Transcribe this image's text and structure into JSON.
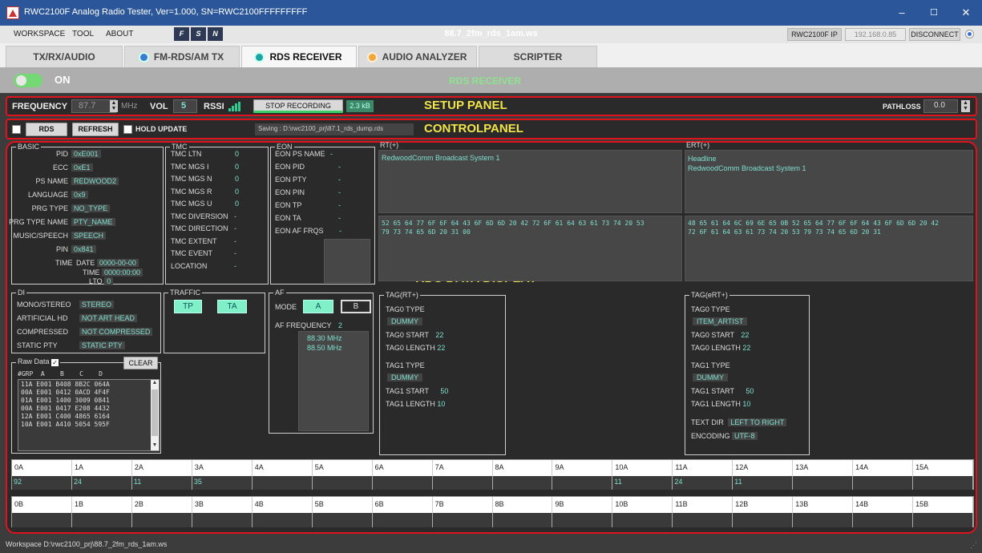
{
  "window": {
    "title": "RWC2100F Analog Radio Tester, Ver=1.000, SN=RWC2100FFFFFFFFF",
    "minimize": "–",
    "maximize": "☐",
    "close": "✕"
  },
  "menu": {
    "items": [
      "WORKSPACE",
      "TOOL",
      "ABOUT"
    ],
    "toolbar_icons": [
      "F",
      "S",
      "N"
    ],
    "file": "88.7_2fm_rds_1am.ws",
    "ip_label": "RWC2100F IP",
    "ip_value": "192.168.0.85",
    "disconnect": "DISCONNECT"
  },
  "tabs": [
    {
      "label": "TX/RX/AUDIO"
    },
    {
      "label": "FM-RDS/AM TX",
      "dot": "#3a7bd5"
    },
    {
      "label": "RDS RECEIVER",
      "dot": "#19a5a5"
    },
    {
      "label": "AUDIO ANALYZER",
      "dot": "#f3a73b"
    },
    {
      "label": "SCRIPTER"
    }
  ],
  "power": {
    "state": "ON",
    "title": "RDS RECEIVER"
  },
  "setup": {
    "frequency_label": "FREQUENCY",
    "frequency": "87.7",
    "unit": "MHz",
    "vol_label": "VOL",
    "vol": "5",
    "rssi_label": "RSSI",
    "recording_btn": "STOP RECORDING",
    "size": "2.3 kB",
    "panel_label": "SETUP PANEL",
    "pathloss_label": "PATHLOSS",
    "pathloss": "0.0"
  },
  "control": {
    "rds_btn": "RDS",
    "refresh_btn": "REFRESH",
    "hold_update": "HOLD UPDATE",
    "saving": "Saving : D:\\rwc2100_prj\\87.1_rds_dump.rds",
    "panel_label": "CONTROLPANEL"
  },
  "display_label": "RDS DATA DISPLAY",
  "basic": {
    "title": "BASIC",
    "pid_l": "PID",
    "pid": "0xE001",
    "ecc_l": "ECC",
    "ecc": "0xE1",
    "ps_l": "PS NAME",
    "ps": "REDWOOD2",
    "lang_l": "LANGUAGE",
    "lang": "0x9",
    "prg_l": "PRG TYPE",
    "prg": "NO_TYPE",
    "prgn_l": "PRG TYPE NAME",
    "prgn": "PTY_NAME",
    "ms_l": "MUSIC/SPEECH",
    "ms": "SPEECH",
    "pin_l": "PIN",
    "pin": "0x841",
    "time_l": "TIME",
    "date_l": "DATE",
    "date": "0000-00-00",
    "time2_l": "TIME",
    "time2": "0000:00:00",
    "lto_l": "LTO",
    "lto": "0"
  },
  "tmc": {
    "title": "TMC",
    "rows": [
      {
        "l": "TMC LTN",
        "v": "0"
      },
      {
        "l": "TMC MGS I",
        "v": "0"
      },
      {
        "l": "TMC MGS N",
        "v": "0"
      },
      {
        "l": "TMC MGS R",
        "v": "0"
      },
      {
        "l": "TMC MGS U",
        "v": "0"
      },
      {
        "l": "TMC DIVERSION",
        "v": "-"
      },
      {
        "l": "TMC DIRECTION",
        "v": "-"
      },
      {
        "l": "TMC EXTENT",
        "v": "-"
      },
      {
        "l": "TMC EVENT",
        "v": "-"
      },
      {
        "l": "LOCATION",
        "v": "-"
      }
    ]
  },
  "eon": {
    "title": "EON",
    "rows": [
      {
        "l": "EON PS NAME",
        "v": "-"
      },
      {
        "l": "EON PID",
        "v": "-"
      },
      {
        "l": "EON PTY",
        "v": "-"
      },
      {
        "l": "EON PIN",
        "v": "-"
      },
      {
        "l": "EON TP",
        "v": "-"
      },
      {
        "l": "EON TA",
        "v": "-"
      },
      {
        "l": "EON AF FRQS",
        "v": "-"
      }
    ]
  },
  "rt": {
    "title": "RT(+)",
    "text": "RedwoodComm Broadcast System 1",
    "hex": "52 65 64 77 6F 6F 64 43 6F 6D 6D 20 42 72 6F 61 64 63 61 73 74 20 53\n79 73 74 65 6D 20 31 00"
  },
  "ert": {
    "title": "ERT(+)",
    "text1": "Headline",
    "text2": "RedwoodComm Broadcast System 1",
    "hex": "48 65 61 64 6C 69 6E 65 0B 52 65 64 77 6F 6F 64 43 6F 6D 6D 20 42\n72 6F 61 64 63 61 73 74 20 53 79 73 74 65 6D 20 31"
  },
  "di": {
    "title": "DI",
    "ms_l": "MONO/STEREO",
    "ms": "STEREO",
    "ah_l": "ARTIFICIAL HD",
    "ah": "NOT ART HEAD",
    "cmp_l": "COMPRESSED",
    "cmp": "NOT COMPRESSED",
    "sp_l": "STATIC PTY",
    "sp": "STATIC PTY"
  },
  "traffic": {
    "title": "TRAFFIC",
    "tp": "TP",
    "ta": "TA"
  },
  "af": {
    "title": "AF",
    "mode_l": "MODE",
    "a": "A",
    "b": "B",
    "freq_l": "AF FREQUENCY",
    "freq_n": "2",
    "f1": "88.30 MHz",
    "f2": "88.50 MHz"
  },
  "tag_rt": {
    "title": "TAG(RT+)",
    "t0type_l": "TAG0 TYPE",
    "t0type": "DUMMY",
    "t0s_l": "TAG0 START",
    "t0s": "22",
    "t0len_l": "TAG0 LENGTH",
    "t0len": "22",
    "t1type_l": "TAG1 TYPE",
    "t1type": "DUMMY",
    "t1s_l": "TAG1 START",
    "t1s": "50",
    "t1len_l": "TAG1 LENGTH",
    "t1len": "10"
  },
  "tag_ert": {
    "title": "TAG(eRT+)",
    "t0type_l": "TAG0 TYPE",
    "t0type": "ITEM_ARTIST",
    "t0s_l": "TAG0 START",
    "t0s": "22",
    "t0len_l": "TAG0 LENGTH",
    "t0len": "22",
    "t1type_l": "TAG1 TYPE",
    "t1type": "DUMMY",
    "t1s_l": "TAG1 START",
    "t1s": "50",
    "t1len_l": "TAG1 LENGTH",
    "t1len": "10",
    "dir_l": "TEXT DIR",
    "dir": "LEFT TO RIGHT",
    "enc_l": "ENCODING",
    "enc": "UTF-8"
  },
  "raw": {
    "title": "Raw Data",
    "clear": "CLEAR",
    "header": "#GRP  A    B    C    D",
    "lines": [
      "11A E001 B408 8B2C 064A",
      "00A E001 0412 0ACD 4F4F",
      "01A E001 1400 3009 0841",
      "00A E001 0417 E208 4432",
      "12A E001 C400 4865 6164",
      "10A E001 A410 5054 595F"
    ]
  },
  "groups_a": {
    "labels": [
      "0A",
      "1A",
      "2A",
      "3A",
      "4A",
      "5A",
      "6A",
      "7A",
      "8A",
      "9A",
      "10A",
      "11A",
      "12A",
      "13A",
      "14A",
      "15A"
    ],
    "values": [
      "92",
      "24",
      "11",
      "35",
      "",
      "",
      "",
      "",
      "",
      "",
      "11",
      "24",
      "11",
      "",
      "",
      ""
    ]
  },
  "groups_b": {
    "labels": [
      "0B",
      "1B",
      "2B",
      "3B",
      "4B",
      "5B",
      "6B",
      "7B",
      "8B",
      "9B",
      "10B",
      "11B",
      "12B",
      "13B",
      "14B",
      "15B"
    ],
    "values": [
      "",
      "",
      "",
      "",
      "",
      "",
      "",
      "",
      "",
      "",
      "",
      "",
      "",
      "",
      "",
      ""
    ]
  },
  "status": {
    "workspace": "Workspace  D:\\rwc2100_prj\\88.7_2fm_rds_1am.ws"
  }
}
